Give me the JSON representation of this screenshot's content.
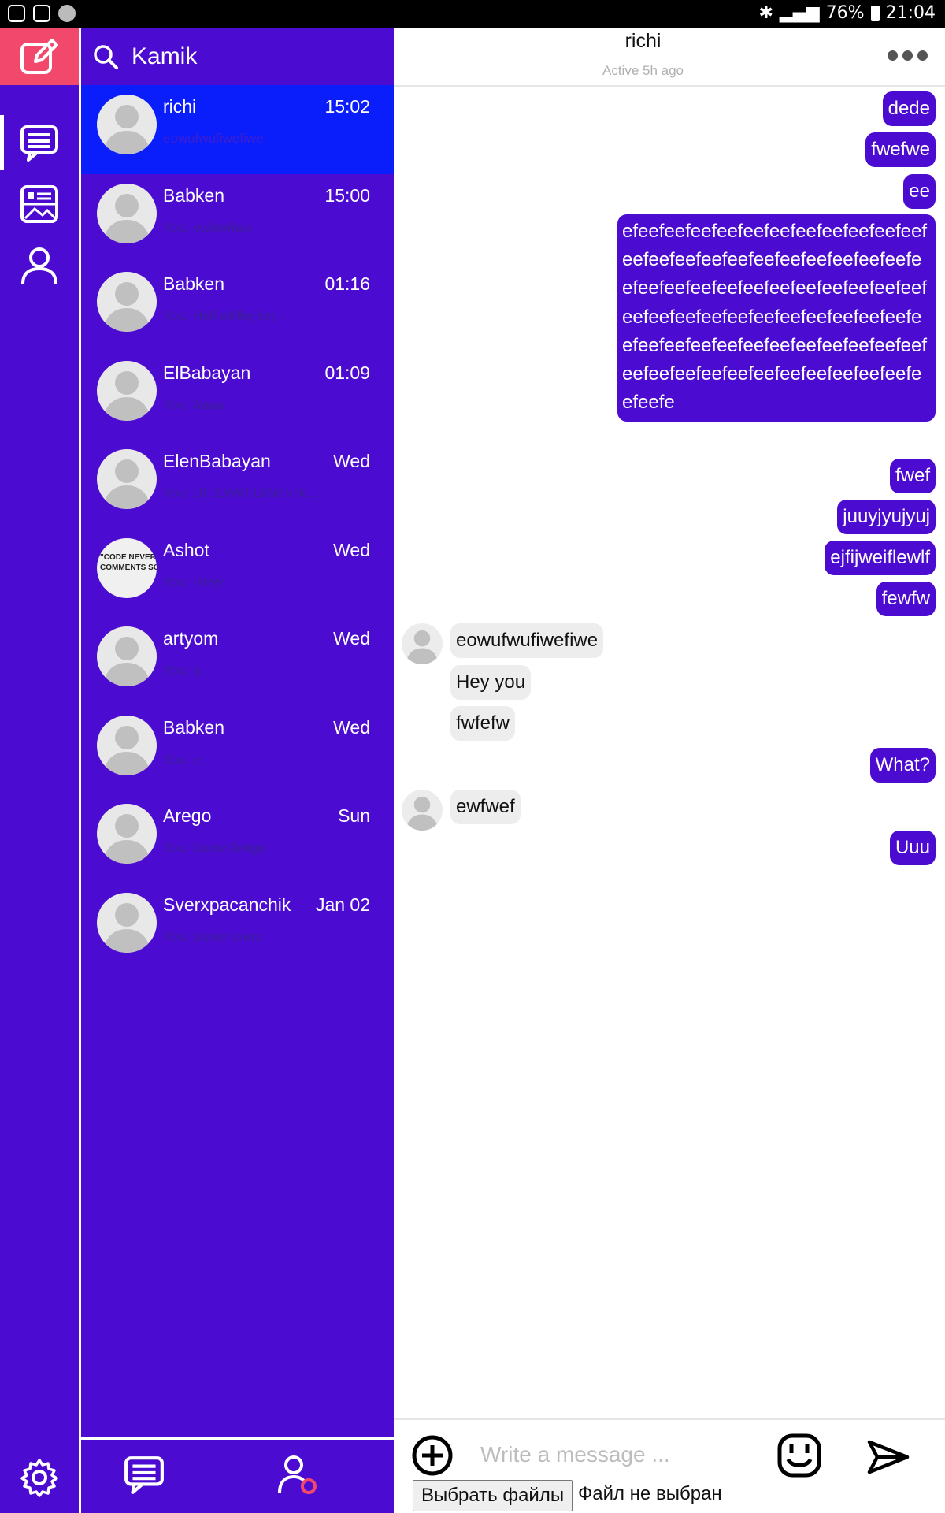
{
  "status_bar": {
    "battery": "76%",
    "time": "21:04"
  },
  "search": {
    "label": "Kamik"
  },
  "conversations": [
    {
      "name": "richi",
      "time": "15:02",
      "preview": "eowufwufiwefiwe",
      "selected": true,
      "avatar": "default"
    },
    {
      "name": "Babken",
      "time": "15:00",
      "preview": "You: ewfewfwe",
      "avatar": "default"
    },
    {
      "name": "Babken",
      "time": "01:16",
      "preview": "You: Hell wkflej kej...",
      "avatar": "default"
    },
    {
      "name": "ElBabayan",
      "time": "01:09",
      "preview": "You: Aaaa",
      "avatar": "default"
    },
    {
      "name": "ElenBabayan",
      "time": "Wed",
      "preview": "You: DF;EWKFLKW k;lk...",
      "avatar": "default"
    },
    {
      "name": "Ashot",
      "time": "Wed",
      "preview": "You: Heyy",
      "avatar": "meme",
      "avatar_text": [
        "\"CODE NEVER LI",
        "COMMENTS SOM"
      ]
    },
    {
      "name": "artyom",
      "time": "Wed",
      "preview": "You: a",
      "avatar": "default"
    },
    {
      "name": "Babken",
      "time": "Wed",
      "preview": "You: e",
      "avatar": "default"
    },
    {
      "name": "Arego",
      "time": "Sun",
      "preview": "You: barev Arego",
      "avatar": "default"
    },
    {
      "name": "Sverxpacanchik",
      "time": "Jan 02",
      "preview": "You: barev sverx",
      "avatar": "default"
    }
  ],
  "chat": {
    "title": "richi",
    "subtitle": "Active 5h ago",
    "messages": [
      {
        "dir": "out",
        "text": "dede"
      },
      {
        "dir": "out",
        "text": "fwefwe"
      },
      {
        "dir": "out",
        "text": "ee"
      },
      {
        "dir": "out",
        "text": "efeefeefeefeefeefeefeefeefeefeefeefeefeefeefeefeefeefeefeefeefeefeefeefeefeefeefeefeefeefeefeefeefeefeefeefeefeefeefeefeefeefeefeefeefeefeefeefeefeefeefeefeefeefeefeefeefeefeefeefeefeefeefeefeefeefeefeefeefeefeefe"
      },
      {
        "dir": "out",
        "text": "fwef"
      },
      {
        "dir": "out",
        "text": "juuyjyujyuj"
      },
      {
        "dir": "out",
        "text": "ejfijweiflewlf"
      },
      {
        "dir": "out",
        "text": "fewfw"
      },
      {
        "dir": "in",
        "text": "eowufwufiwefiwe",
        "avatar": true
      },
      {
        "dir": "in",
        "text": "Hey you"
      },
      {
        "dir": "in",
        "text": "fwfefw"
      },
      {
        "dir": "out",
        "text": "What?"
      },
      {
        "dir": "in",
        "text": "ewfwef",
        "avatar": true
      },
      {
        "dir": "out",
        "text": "Uuu"
      }
    ]
  },
  "composer": {
    "placeholder": "Write a message ...",
    "file_button": "Выбрать файлы",
    "file_status": "Файл не выбран"
  },
  "colors": {
    "primary": "#4c0bd1",
    "selected": "#0a1efc",
    "compose": "#f1486c"
  }
}
